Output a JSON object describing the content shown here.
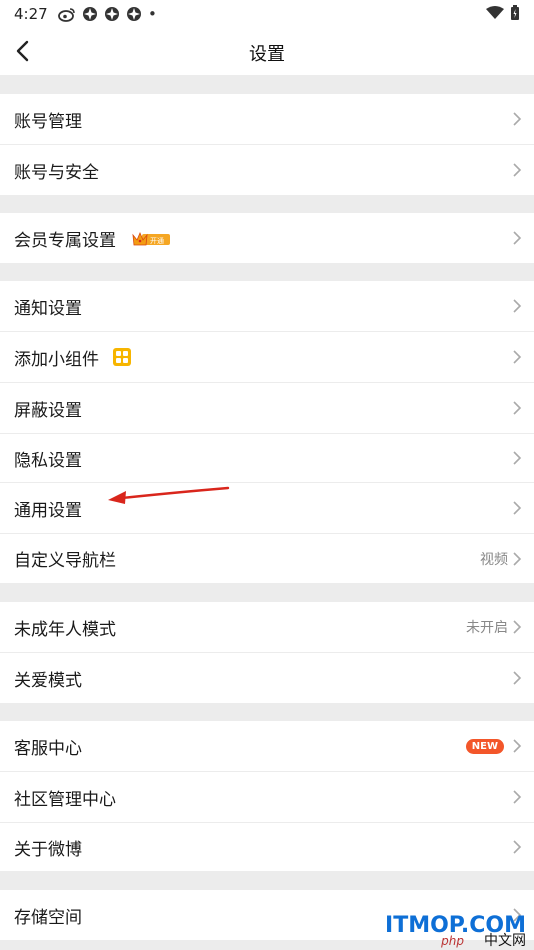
{
  "status_bar": {
    "time": "4:27",
    "dot": "•"
  },
  "header": {
    "title": "设置"
  },
  "groups": [
    {
      "items": [
        {
          "label": "账号管理"
        },
        {
          "label": "账号与安全"
        }
      ]
    },
    {
      "items": [
        {
          "label": "会员专属设置",
          "badge_text": "开通"
        }
      ]
    },
    {
      "items": [
        {
          "label": "通知设置"
        },
        {
          "label": "添加小组件"
        },
        {
          "label": "屏蔽设置"
        },
        {
          "label": "隐私设置"
        },
        {
          "label": "通用设置"
        },
        {
          "label": "自定义导航栏",
          "value": "视频"
        }
      ]
    },
    {
      "items": [
        {
          "label": "未成年人模式",
          "value": "未开启"
        },
        {
          "label": "关爱模式"
        }
      ]
    },
    {
      "items": [
        {
          "label": "客服中心",
          "badge": "NEW"
        },
        {
          "label": "社区管理中心"
        },
        {
          "label": "关于微博"
        }
      ]
    },
    {
      "items": [
        {
          "label": "存储空间"
        }
      ]
    }
  ],
  "watermark": {
    "brand": "ITMOP.COM",
    "php": "php",
    "cn": "中文网"
  },
  "colors": {
    "background": "#ececec",
    "row_bg": "#ffffff",
    "new_badge": "#f3562a",
    "annotation_arrow": "#d9261c",
    "vip_badge": "#f5a623",
    "widget_icon": "#f7b500"
  }
}
